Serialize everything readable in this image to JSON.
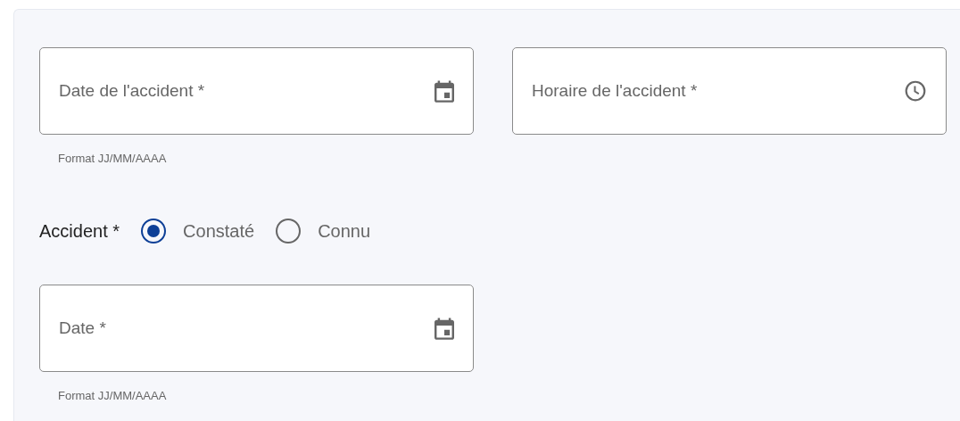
{
  "accident_date": {
    "placeholder": "Date de l'accident *",
    "kind": "date",
    "helper": "Format JJ/MM/AAAA"
  },
  "accident_time": {
    "placeholder": "Horaire de l'accident *",
    "kind": "time"
  },
  "accident": {
    "label": "Accident *",
    "options": [
      {
        "label": "Constaté",
        "selected": true
      },
      {
        "label": "Connu",
        "selected": false
      }
    ]
  },
  "date": {
    "placeholder": "Date *",
    "kind": "date",
    "helper": "Format JJ/MM/AAAA"
  }
}
